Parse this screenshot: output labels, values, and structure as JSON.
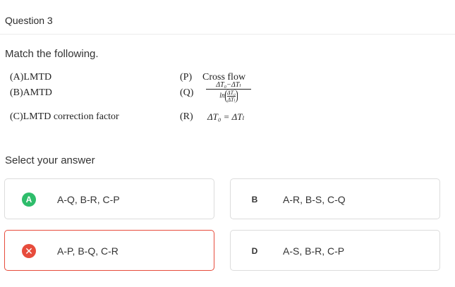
{
  "question": {
    "title": "Question 3",
    "prompt": "Match the following."
  },
  "match_table": {
    "left": [
      {
        "label": "(A)LMTD"
      },
      {
        "label": "(B)AMTD"
      },
      {
        "label": "(C)LMTD correction factor"
      }
    ],
    "right": [
      {
        "tag": "(P)",
        "text": "Cross flow"
      },
      {
        "tag": "(Q)",
        "formula_num": "ΔT₀−ΔTₗ",
        "formula_ln": "ln",
        "formula_in_num": "ΔT₀",
        "formula_in_den": "ΔTₗ"
      },
      {
        "tag": "(R)",
        "equation": "ΔT₀ = ΔTₗ"
      }
    ]
  },
  "answers": {
    "label": "Select your answer",
    "options": [
      {
        "badge": "A",
        "text": "A-Q, B-R, C-P",
        "state": "correct",
        "badge_color": "#2ebd6b"
      },
      {
        "badge": "B",
        "text": "A-R, B-S, C-Q",
        "state": "neutral"
      },
      {
        "badge": "✕",
        "text": "A-P, B-Q, C-R",
        "state": "wrong",
        "badge_color": "#e74c3c"
      },
      {
        "badge": "D",
        "text": "A-S, B-R, C-P",
        "state": "neutral"
      }
    ]
  }
}
